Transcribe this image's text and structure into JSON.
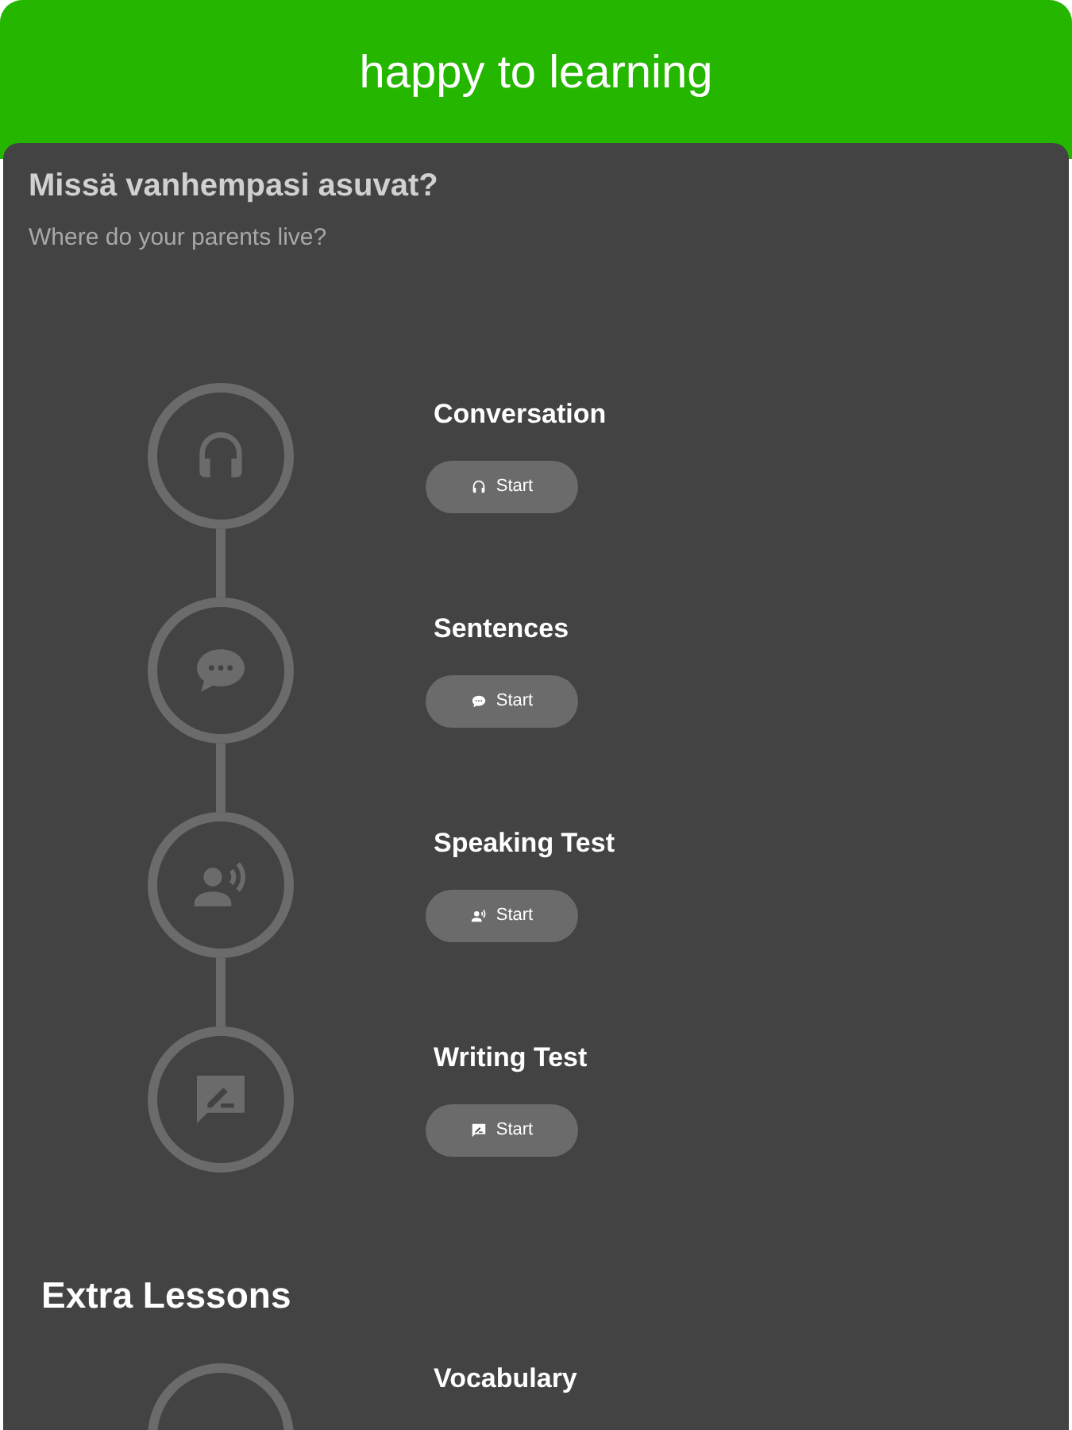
{
  "app_bar": {
    "title": "happy to learning"
  },
  "question": {
    "text": "Missä vanhempasi asuvat?",
    "translation": "Where do your parents live?"
  },
  "lessons": [
    {
      "kind": "listening",
      "title": "Conversation",
      "button": "Start"
    },
    {
      "kind": "chat",
      "title": "Sentences",
      "button": "Start"
    },
    {
      "kind": "speaking",
      "title": "Speaking Test",
      "button": "Start"
    },
    {
      "kind": "writing",
      "title": "Writing Test",
      "button": "Start"
    }
  ],
  "extra": {
    "heading": "Extra Lessons",
    "lessons": [
      {
        "title": "Vocabulary"
      }
    ]
  }
}
